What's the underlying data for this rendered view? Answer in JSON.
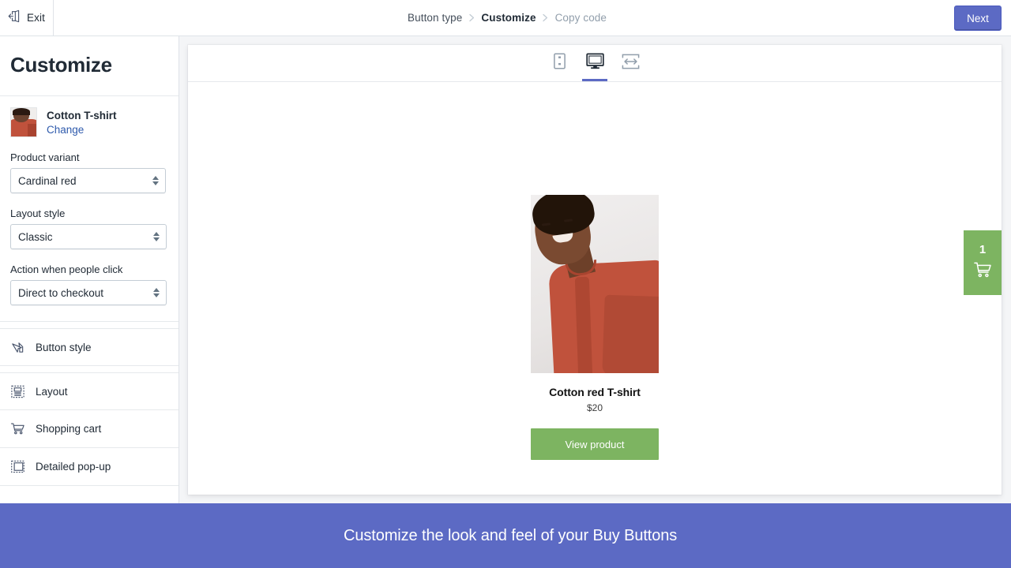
{
  "topbar": {
    "exit_label": "Exit",
    "exit_icon": "exit-door-icon",
    "next_label": "Next",
    "breadcrumbs": [
      {
        "label": "Button type",
        "state": "done"
      },
      {
        "label": "Customize",
        "state": "active"
      },
      {
        "label": "Copy code",
        "state": "upcoming"
      }
    ],
    "separator": "chevron-right-icon"
  },
  "sidebar": {
    "title": "Customize",
    "product": {
      "name": "Cotton T-shirt",
      "change_label": "Change",
      "thumbnail": "product-thumbnail"
    },
    "fields": [
      {
        "label": "Product variant",
        "value": "Cardinal red"
      },
      {
        "label": "Layout style",
        "value": "Classic"
      },
      {
        "label": "Action when people click",
        "value": "Direct to checkout"
      }
    ],
    "nav_items": [
      {
        "label": "Button style",
        "icon": "cursor-click-icon"
      },
      {
        "label": "Layout",
        "icon": "layout-grid-icon"
      },
      {
        "label": "Shopping cart",
        "icon": "shopping-cart-icon"
      },
      {
        "label": "Detailed pop-up",
        "icon": "popup-window-icon"
      }
    ]
  },
  "preview": {
    "devices": [
      {
        "name": "mobile",
        "icon": "mobile-phone-icon",
        "active": false
      },
      {
        "name": "desktop",
        "icon": "desktop-monitor-icon",
        "active": true
      },
      {
        "name": "responsive",
        "icon": "responsive-width-icon",
        "active": false
      }
    ],
    "product": {
      "title": "Cotton red T-shirt",
      "price": "$20",
      "buy_label": "View product",
      "image": "woman-in-red-tshirt-photo"
    },
    "cart": {
      "count": "1",
      "icon": "shopping-cart-icon"
    }
  },
  "banner": {
    "text": "Customize the look and feel of your Buy Buttons"
  },
  "colors": {
    "accent": "#5c6ac4",
    "buy_button": "#7db461",
    "link": "#2e5aac",
    "text": "#212b36",
    "banner_bg": "#5c6ac4"
  }
}
